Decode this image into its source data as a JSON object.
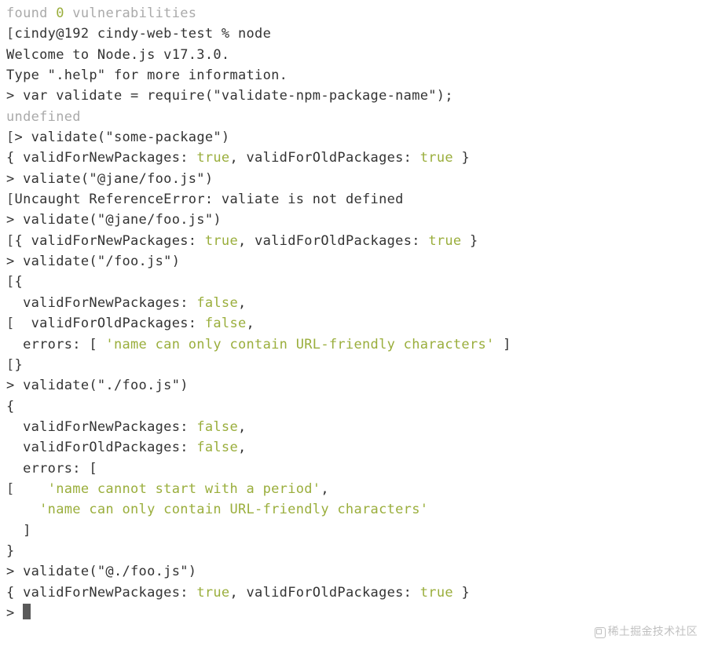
{
  "lines": {
    "l0": "found ",
    "l0b": "0",
    "l0c": " vulnerabilities",
    "l1a": "[",
    "l1b": "cindy@192 cindy-web-test % node",
    "l2": "Welcome to Node.js v17.3.0.",
    "l3": "Type \".help\" for more information.",
    "l4": "> var validate = require(\"validate-npm-package-name\");",
    "l5": "undefined",
    "l6a": "[",
    "l6b": "> validate(\"some-package\")",
    "l7a": "{ validForNewPackages: ",
    "l7b": "true",
    "l7c": ", validForOldPackages: ",
    "l7d": "true",
    "l7e": " }",
    "l8": "> valiate(\"@jane/foo.js\")",
    "l9a": "[",
    "l9b": "Uncaught ReferenceError: valiate is not defined",
    "l10": "> validate(\"@jane/foo.js\")",
    "l11a": "[",
    "l11b": "{ validForNewPackages: ",
    "l11c": "true",
    "l11d": ", validForOldPackages: ",
    "l11e": "true",
    "l11f": " }",
    "l12": "> validate(\"/foo.js\")",
    "l13a": "[",
    "l13b": "{",
    "l14a": "  validForNewPackages: ",
    "l14b": "false",
    "l14c": ",",
    "l15a": "[",
    "l15b": "  validForOldPackages: ",
    "l15c": "false",
    "l15d": ",",
    "l16a": "  errors: [ ",
    "l16b": "'name can only contain URL-friendly characters'",
    "l16c": " ]",
    "l17a": "[",
    "l17b": "}",
    "l18": "> validate(\"./foo.js\")",
    "l19": "{",
    "l20a": "  validForNewPackages: ",
    "l20b": "false",
    "l20c": ",",
    "l21a": "  validForOldPackages: ",
    "l21b": "false",
    "l21c": ",",
    "l22": "  errors: [",
    "l23a": "[",
    "l23b": "    ",
    "l23c": "'name cannot start with a period'",
    "l23d": ",",
    "l24a": "    ",
    "l24b": "'name can only contain URL-friendly characters'",
    "l25": "  ]",
    "l26": "}",
    "l27": "> validate(\"@./foo.js\")",
    "l28a": "{ validForNewPackages: ",
    "l28b": "true",
    "l28c": ", validForOldPackages: ",
    "l28d": "true",
    "l28e": " }",
    "l29": "> "
  },
  "watermark": "稀土掘金技术社区"
}
